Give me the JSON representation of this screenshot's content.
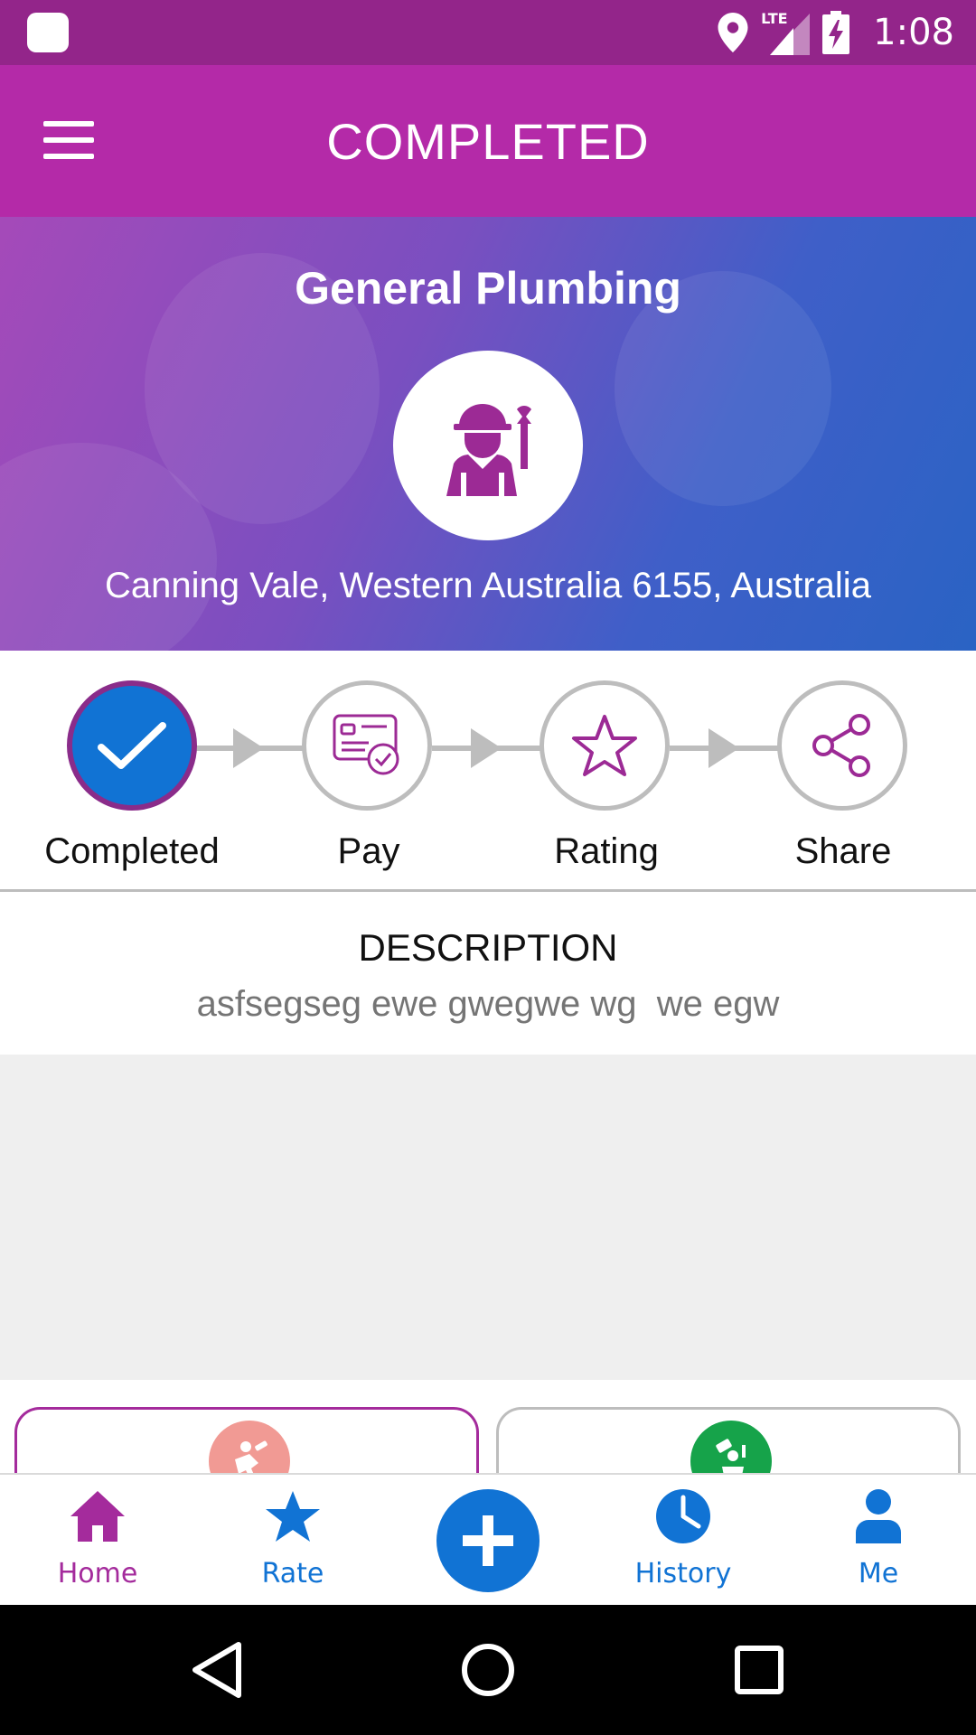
{
  "status_bar": {
    "time": "1:08",
    "network": "LTE"
  },
  "app_bar": {
    "title": "COMPLETED"
  },
  "hero": {
    "service": "General Plumbing",
    "address": "Canning Vale, Western Australia 6155, Australia"
  },
  "steps": [
    {
      "label": "Completed",
      "icon": "check-icon",
      "active": true
    },
    {
      "label": "Pay",
      "icon": "payment-card-icon",
      "active": false
    },
    {
      "label": "Rating",
      "icon": "star-outline-icon",
      "active": false
    },
    {
      "label": "Share",
      "icon": "share-icon",
      "active": false
    }
  ],
  "description": {
    "heading": "DESCRIPTION",
    "text": "asfsegseg ewe gwegwe wg  we egw"
  },
  "bottom_nav": {
    "items": [
      {
        "label": "Home",
        "icon": "home-icon",
        "color": "#a42b9c"
      },
      {
        "label": "Rate",
        "icon": "star-icon",
        "color": "#1173d4"
      },
      {
        "label": "History",
        "icon": "clock-icon",
        "color": "#1173d4"
      },
      {
        "label": "Me",
        "icon": "person-icon",
        "color": "#1173d4"
      }
    ],
    "fab_icon": "plus-icon"
  },
  "colors": {
    "primary": "#b42aa8",
    "status_bar": "#93258a",
    "accent_blue": "#1173d4"
  }
}
